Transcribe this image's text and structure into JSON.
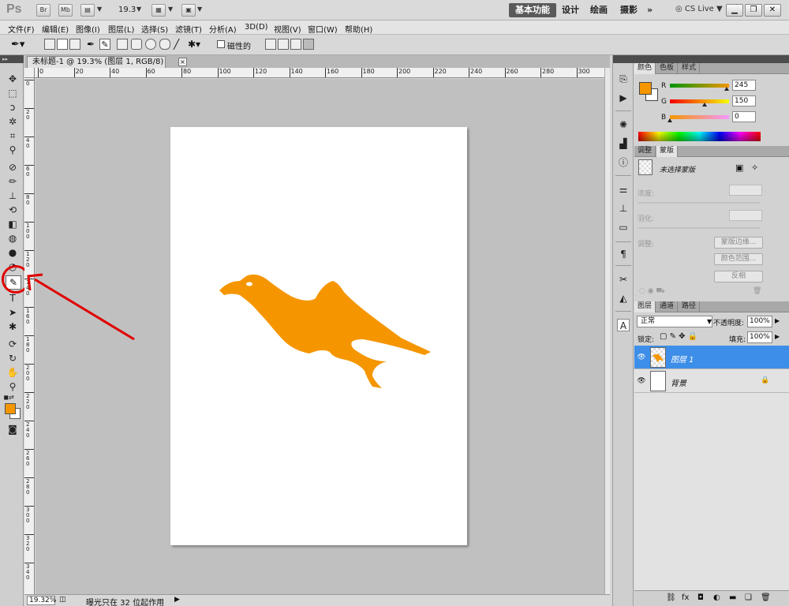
{
  "app": {
    "logo": "Ps",
    "zoom_value": "19.3",
    "top_buttons": [
      "Br",
      "Mb"
    ],
    "workspaces": [
      "基本功能",
      "设计",
      "绘画",
      "摄影",
      "»"
    ],
    "cs_live": "CS Live"
  },
  "menu": [
    "文件(F)",
    "编辑(E)",
    "图像(I)",
    "图层(L)",
    "选择(S)",
    "滤镜(T)",
    "分析(A)",
    "3D(D)",
    "视图(V)",
    "窗口(W)",
    "帮助(H)"
  ],
  "options": {
    "magnetic_label": "磁性的",
    "magnetic_checked": false
  },
  "document": {
    "tab_title": "未标题-1 @ 19.3% (图层 1, RGB/8) *",
    "close_glyph": "×",
    "ruler_top_labels": [
      "0",
      "20",
      "40",
      "60",
      "80",
      "100",
      "120",
      "140",
      "160",
      "180",
      "200",
      "220",
      "240",
      "260",
      "280",
      "300"
    ],
    "ruler_left_labels": [
      "0",
      "20",
      "40",
      "60",
      "80",
      "100",
      "120",
      "140",
      "160",
      "180",
      "200",
      "220",
      "240",
      "260",
      "280",
      "300",
      "320",
      "340"
    ],
    "shape_color": "#f59600"
  },
  "status": {
    "zoom": "19.32%",
    "text": "曝光只在 32 位起作用"
  },
  "panels": {
    "color_tabs": [
      "颜色",
      "色板",
      "样式"
    ],
    "color": {
      "fg": "#f59600",
      "channels": [
        {
          "label": "R",
          "value": "245",
          "fraction": 0.96
        },
        {
          "label": "G",
          "value": "150",
          "fraction": 0.59
        },
        {
          "label": "B",
          "value": "0",
          "fraction": 0.0
        }
      ]
    },
    "mask_tabs": [
      "调整",
      "蒙版"
    ],
    "masks": {
      "title": "未选择蒙版",
      "density_label": "浓度:",
      "feather_label": "羽化:",
      "refine_label": "调整:",
      "btn_edge": "蒙版边缘...",
      "btn_color_range": "颜色范围...",
      "btn_invert": "反相"
    },
    "layer_tabs": [
      "图层",
      "通道",
      "路径"
    ],
    "layers": {
      "blend_mode": "正常",
      "opacity_label": "不透明度:",
      "opacity": "100%",
      "lock_label": "锁定:",
      "fill_label": "填充:",
      "fill": "100%",
      "items": [
        {
          "name": "图层 1",
          "selected": true
        },
        {
          "name": "背景",
          "selected": false
        }
      ]
    }
  }
}
